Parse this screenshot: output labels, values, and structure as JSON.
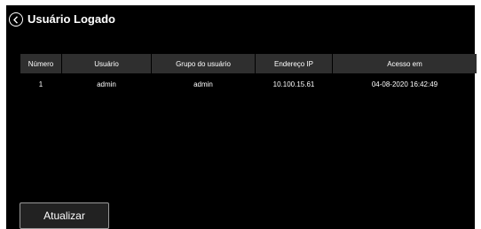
{
  "dialog": {
    "title": "Usuário Logado",
    "back_icon": "circle-chevron-left-icon",
    "close_icon": "close-icon"
  },
  "table": {
    "columns": [
      "Número",
      "Usuário",
      "Grupo do usuário",
      "Endereço IP",
      "Acesso em"
    ],
    "rows": [
      {
        "number": "1",
        "user": "admin",
        "group": "admin",
        "ip": "10.100.15.61",
        "access": "04-08-2020 16:42:49"
      }
    ]
  },
  "footer": {
    "refresh_label": "Atualizar"
  },
  "colors": {
    "background": "#000000",
    "header_cell": "#2f2f2f",
    "text": "#ffffff",
    "button_border": "#9a9a9a"
  }
}
